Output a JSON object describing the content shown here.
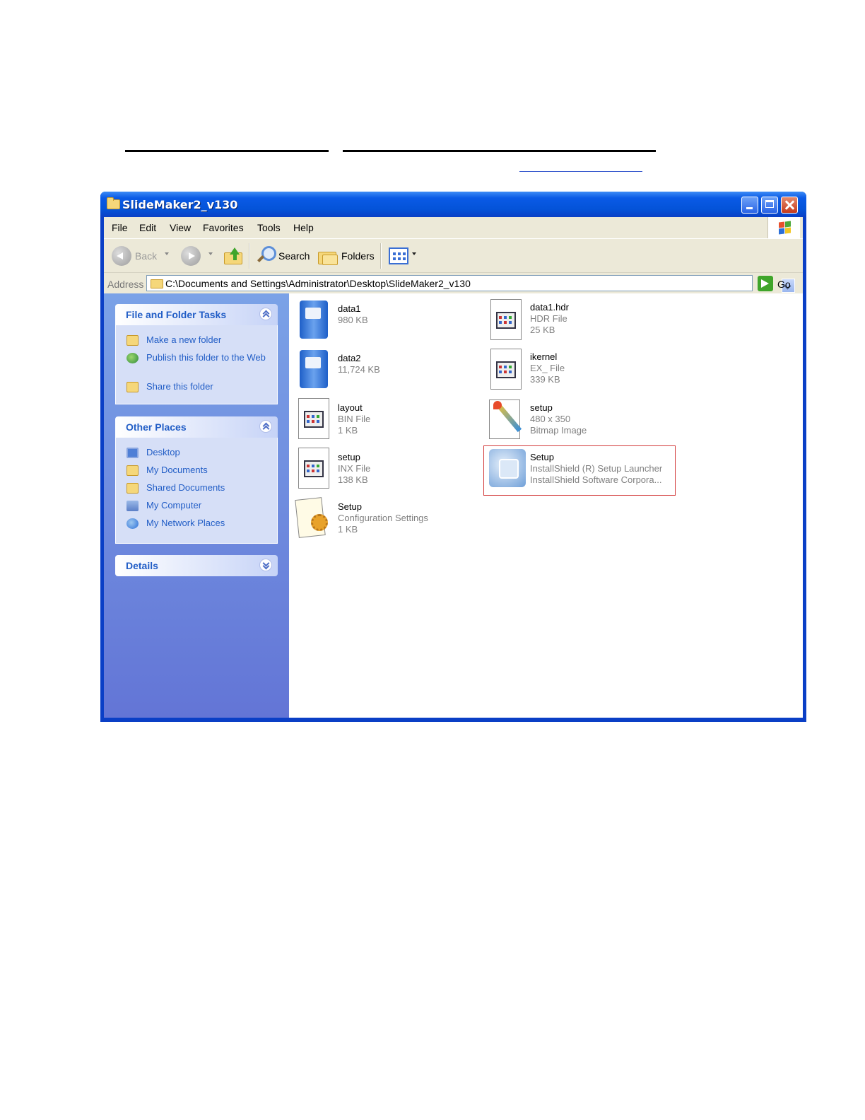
{
  "window": {
    "title": "SlideMaker2_v130"
  },
  "menu": [
    "File",
    "Edit",
    "View",
    "Favorites",
    "Tools",
    "Help"
  ],
  "toolbar": {
    "back": "Back",
    "search": "Search",
    "folders": "Folders"
  },
  "address": {
    "label": "Address",
    "path": "C:\\Documents and Settings\\Administrator\\Desktop\\SlideMaker2_v130",
    "go": "Go"
  },
  "sidebar": {
    "file_tasks": {
      "title": "File and Folder Tasks",
      "items": [
        "Make a new folder",
        "Publish this folder to the Web",
        "Share this folder"
      ]
    },
    "other_places": {
      "title": "Other Places",
      "items": [
        "Desktop",
        "My Documents",
        "Shared Documents",
        "My Computer",
        "My Network Places"
      ]
    },
    "details": {
      "title": "Details"
    }
  },
  "files": [
    {
      "name": "data1",
      "meta1": "980 KB",
      "meta2": "",
      "icon": "cabinet-icon"
    },
    {
      "name": "data1.hdr",
      "meta1": "HDR File",
      "meta2": "25 KB",
      "icon": "generic-file-icon"
    },
    {
      "name": "data2",
      "meta1": "11,724 KB",
      "meta2": "",
      "icon": "cabinet-icon"
    },
    {
      "name": "ikernel",
      "meta1": "EX_ File",
      "meta2": "339 KB",
      "icon": "generic-file-icon"
    },
    {
      "name": "layout",
      "meta1": "BIN File",
      "meta2": "1 KB",
      "icon": "generic-file-icon"
    },
    {
      "name": "setup",
      "meta1": "480 x 350",
      "meta2": "Bitmap Image",
      "icon": "paint-icon"
    },
    {
      "name": "setup",
      "meta1": "INX File",
      "meta2": "138 KB",
      "icon": "generic-file-icon"
    },
    {
      "name": "Setup",
      "meta1": "InstallShield (R) Setup Launcher",
      "meta2": "InstallShield Software Corpora...",
      "icon": "installer-icon"
    },
    {
      "name": "Setup",
      "meta1": "Configuration Settings",
      "meta2": "1 KB",
      "icon": "settings-file-icon"
    }
  ],
  "colors": {
    "titlebar": "#0453d8",
    "sidebar": "#6f8ee0",
    "link": "#215dc6",
    "highlight": "#d23a3a"
  }
}
